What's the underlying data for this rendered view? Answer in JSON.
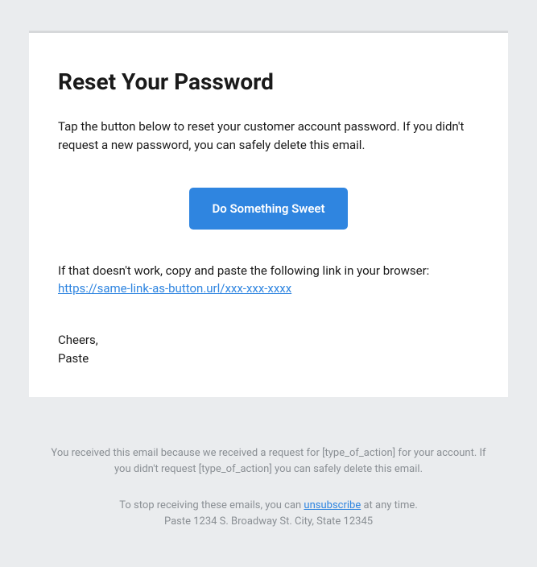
{
  "email": {
    "title": "Reset Your Password",
    "body": "Tap the button below to reset your customer account password. If you didn't request a new password, you can safely delete this email.",
    "button_label": "Do Something Sweet",
    "fallback_intro": "If that doesn't work, copy and paste the following link in your browser:",
    "fallback_link": "https://same-link-as-button.url/xxx-xxx-xxxx",
    "signoff_greeting": "Cheers,",
    "signoff_name": "Paste"
  },
  "footer": {
    "reason": "You received this email because we received a request for [type_of_action] for your account. If you didn't request [type_of_action] you can safely delete this email.",
    "unsubscribe_pre": "To stop receiving these emails, you can ",
    "unsubscribe_link": "unsubscribe",
    "unsubscribe_post": " at any time.",
    "address": "Paste 1234 S. Broadway St. City, State 12345"
  }
}
